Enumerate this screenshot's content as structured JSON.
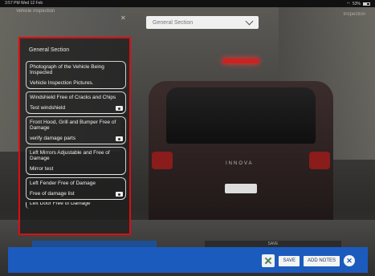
{
  "status": {
    "time": "3:57 PM",
    "date": "Wed 12 Feb",
    "battery": "53%"
  },
  "header": {
    "title": "Vehicle Inspection",
    "right_label": "Inspection",
    "close": "✕",
    "section_select": "General Section"
  },
  "panel": {
    "title": "General Section",
    "items": [
      {
        "label": "Photograph of the Vehicle Being Inspected",
        "type": "head"
      },
      {
        "label": "Vehicle Inspection Pictures.",
        "type": "sub",
        "camera": false
      },
      {
        "label": "Windshield Free of Cracks and Chips",
        "type": "head"
      },
      {
        "label": "Test windshield",
        "type": "sub",
        "camera": true
      },
      {
        "label": "Front Hood, Grill and Bumper Free of Damage",
        "type": "head"
      },
      {
        "label": "verify damage parts",
        "type": "sub",
        "camera": true
      },
      {
        "label": "Left Mirrors Adjustable and Free of Damage",
        "type": "head"
      },
      {
        "label": "Mirror test",
        "type": "sub",
        "camera": false
      },
      {
        "label": "Left Fender Free of Damage",
        "type": "head"
      },
      {
        "label": "Free of damage list",
        "type": "sub",
        "camera": true
      },
      {
        "label": "Left Door Free of Damage",
        "type": "cut"
      }
    ]
  },
  "car_badge": "INNOVA",
  "tabs": {
    "left": "",
    "right": "SAVE"
  },
  "bottom_bar": {
    "save_label": "SAVE",
    "add_notes_label": "ADD NOTES",
    "close_label": "✕"
  },
  "colors": {
    "accent": "#1b5bbd",
    "highlight_border": "#e10b10"
  }
}
